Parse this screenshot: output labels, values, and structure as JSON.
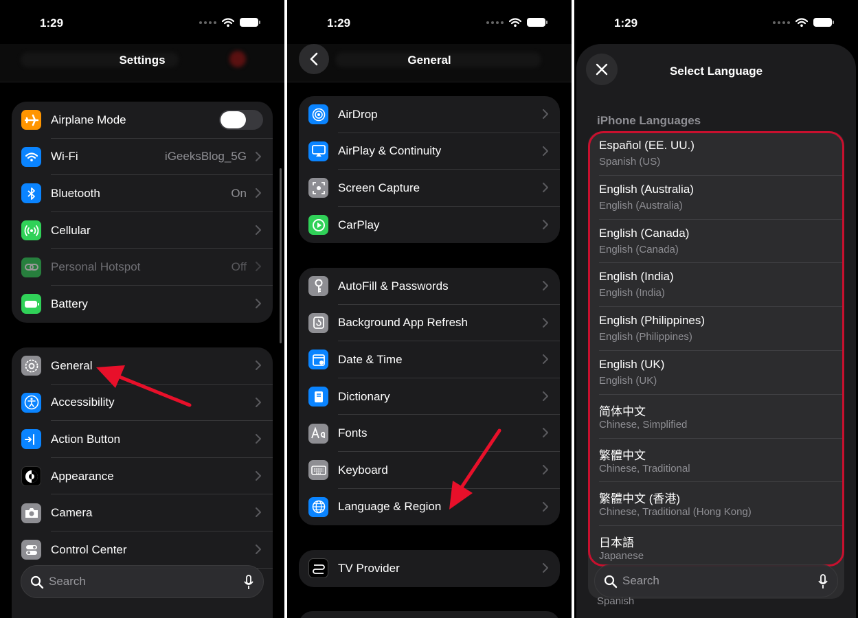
{
  "status": {
    "time": "1:29"
  },
  "settings": {
    "title": "Settings",
    "group1": [
      {
        "label": "Airplane Mode",
        "icon": "airplane-icon",
        "color": "#FF9500",
        "toggle": "off"
      },
      {
        "label": "Wi-Fi",
        "value": "iGeeksBlog_5G",
        "icon": "wifi-icon",
        "color": "#0A84FF"
      },
      {
        "label": "Bluetooth",
        "value": "On",
        "icon": "bluetooth-icon",
        "color": "#0A84FF"
      },
      {
        "label": "Cellular",
        "icon": "cellular-icon",
        "color": "#30D158"
      },
      {
        "label": "Personal Hotspot",
        "value": "Off",
        "icon": "hotspot-icon",
        "color": "#30D158",
        "disabled": true
      },
      {
        "label": "Battery",
        "icon": "battery-icon",
        "color": "#30D158"
      }
    ],
    "group2": [
      {
        "label": "General",
        "icon": "gear-icon",
        "color": "#8E8E93"
      },
      {
        "label": "Accessibility",
        "icon": "accessibility-icon",
        "color": "#0A84FF"
      },
      {
        "label": "Action Button",
        "icon": "action-button-icon",
        "color": "#0A84FF"
      },
      {
        "label": "Appearance",
        "icon": "appearance-icon",
        "color": "#1C1C1E"
      },
      {
        "label": "Camera",
        "icon": "camera-icon",
        "color": "#8E8E93"
      },
      {
        "label": "Control Center",
        "icon": "control-center-icon",
        "color": "#8E8E93"
      }
    ],
    "search_placeholder": "Search"
  },
  "general": {
    "title": "General",
    "group1": [
      {
        "label": "AirDrop",
        "icon": "airdrop-icon",
        "color": "#0A84FF"
      },
      {
        "label": "AirPlay & Continuity",
        "icon": "airplay-icon",
        "color": "#0A84FF"
      },
      {
        "label": "Screen Capture",
        "icon": "screen-capture-icon",
        "color": "#8E8E93"
      },
      {
        "label": "CarPlay",
        "icon": "carplay-icon",
        "color": "#30D158"
      }
    ],
    "group2": [
      {
        "label": "AutoFill & Passwords",
        "icon": "key-icon",
        "color": "#8E8E93"
      },
      {
        "label": "Background App Refresh",
        "icon": "refresh-icon",
        "color": "#8E8E93"
      },
      {
        "label": "Date & Time",
        "icon": "calendar-icon",
        "color": "#0A84FF"
      },
      {
        "label": "Dictionary",
        "icon": "dictionary-icon",
        "color": "#0A84FF"
      },
      {
        "label": "Fonts",
        "icon": "fonts-icon",
        "color": "#8E8E93"
      },
      {
        "label": "Keyboard",
        "icon": "keyboard-icon",
        "color": "#8E8E93"
      },
      {
        "label": "Language & Region",
        "icon": "globe-icon",
        "color": "#0A84FF"
      }
    ],
    "group3": [
      {
        "label": "TV Provider",
        "icon": "tv-provider-icon",
        "color": "#1C1C1E"
      }
    ]
  },
  "select_language": {
    "title": "Select Language",
    "section": "iPhone Languages",
    "languages": [
      {
        "name": "Español (EE. UU.)",
        "sub": "Spanish (US)"
      },
      {
        "name": "English (Australia)",
        "sub": "English (Australia)"
      },
      {
        "name": "English (Canada)",
        "sub": "English (Canada)"
      },
      {
        "name": "English (India)",
        "sub": "English (India)"
      },
      {
        "name": "English (Philippines)",
        "sub": "English (Philippines)"
      },
      {
        "name": "English (UK)",
        "sub": "English (UK)"
      },
      {
        "name": "简体中文",
        "sub": "Chinese, Simplified"
      },
      {
        "name": "繁體中文",
        "sub": "Chinese, Traditional"
      },
      {
        "name": "繁體中文 (香港)",
        "sub": "Chinese, Traditional (Hong Kong)"
      },
      {
        "name": "日本語",
        "sub": "Japanese"
      }
    ],
    "search_placeholder": "Search",
    "peek_text": "Spanish"
  },
  "colors": {
    "annotation_red": "#E8102A",
    "toggle_off": "#39393D"
  }
}
